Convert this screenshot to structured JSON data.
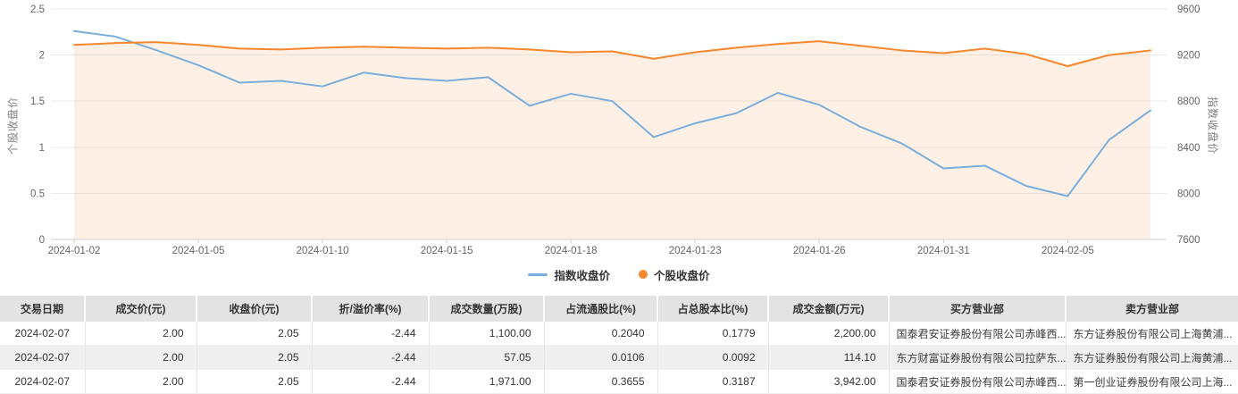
{
  "chart": {
    "left_axis_title": "个股收盘价",
    "right_axis_title": "指数收盘价",
    "legend": [
      {
        "label": "指数收盘价",
        "marker": "line",
        "color": "#79afdc"
      },
      {
        "label": "个股收盘价",
        "marker": "circle",
        "color": "#f8862c"
      }
    ]
  },
  "chart_data": {
    "type": "line",
    "title": "",
    "x": [
      "2024-01-02",
      "2024-01-03",
      "2024-01-04",
      "2024-01-05",
      "2024-01-08",
      "2024-01-09",
      "2024-01-10",
      "2024-01-11",
      "2024-01-12",
      "2024-01-15",
      "2024-01-16",
      "2024-01-17",
      "2024-01-18",
      "2024-01-19",
      "2024-01-22",
      "2024-01-23",
      "2024-01-24",
      "2024-01-25",
      "2024-01-26",
      "2024-01-29",
      "2024-01-30",
      "2024-01-31",
      "2024-02-01",
      "2024-02-02",
      "2024-02-05",
      "2024-02-06",
      "2024-02-07"
    ],
    "x_tick_indices": [
      0,
      3,
      6,
      9,
      12,
      15,
      18,
      21,
      24
    ],
    "x_tick_labels": [
      "2024-01-02",
      "2024-01-05",
      "2024-01-10",
      "2024-01-15",
      "2024-01-18",
      "2024-01-23",
      "2024-01-26",
      "2024-01-31",
      "2024-02-05"
    ],
    "left_ticks": [
      "2.5",
      "2",
      "1.5",
      "1",
      "0.5",
      "0"
    ],
    "right_ticks": [
      "9600",
      "9200",
      "8800",
      "8400",
      "8000",
      "7600"
    ],
    "left_ylim": [
      0,
      2.5
    ],
    "right_ylim": [
      7600,
      9600
    ],
    "grid": true,
    "legend_position": "bottom",
    "series": [
      {
        "name": "指数收盘价",
        "axis": "right",
        "color": "#79afdc",
        "area": false,
        "values": [
          9408,
          9360,
          9240,
          9112,
          8960,
          8976,
          8928,
          9048,
          9000,
          8976,
          9008,
          8760,
          8864,
          8800,
          8488,
          8608,
          8696,
          8872,
          8768,
          8576,
          8432,
          8216,
          8240,
          8064,
          7976,
          8464,
          8720
        ]
      },
      {
        "name": "个股收盘价",
        "axis": "left",
        "color": "#f8862c",
        "area": true,
        "fill": "rgba(249,141,52,0.13)",
        "values": [
          2.11,
          2.13,
          2.14,
          2.11,
          2.07,
          2.06,
          2.08,
          2.09,
          2.08,
          2.07,
          2.08,
          2.06,
          2.03,
          2.04,
          1.96,
          2.03,
          2.08,
          2.12,
          2.15,
          2.1,
          2.05,
          2.02,
          2.07,
          2.01,
          1.88,
          2.0,
          2.05
        ]
      }
    ]
  },
  "table": {
    "columns": [
      {
        "label": "交易日期",
        "align": "center"
      },
      {
        "label": "成交价(元)",
        "align": "right"
      },
      {
        "label": "收盘价(元)",
        "align": "right"
      },
      {
        "label": "折/溢价率(%)",
        "align": "right"
      },
      {
        "label": "成交数量(万股)",
        "align": "right"
      },
      {
        "label": "占流通股比(%)",
        "align": "right"
      },
      {
        "label": "占总股本比(%)",
        "align": "right"
      },
      {
        "label": "成交金额(万元)",
        "align": "right"
      },
      {
        "label": "买方营业部",
        "align": "left"
      },
      {
        "label": "卖方营业部",
        "align": "left"
      }
    ],
    "rows": [
      [
        "2024-02-07",
        "2.00",
        "2.05",
        "-2.44",
        "1,100.00",
        "0.2040",
        "0.1779",
        "2,200.00",
        "国泰君安证券股份有限公司赤峰西...",
        "东方证券股份有限公司上海黄浦..."
      ],
      [
        "2024-02-07",
        "2.00",
        "2.05",
        "-2.44",
        "57.05",
        "0.0106",
        "0.0092",
        "114.10",
        "东方财富证券股份有限公司拉萨东...",
        "东方证券股份有限公司上海黄浦..."
      ],
      [
        "2024-02-07",
        "2.00",
        "2.05",
        "-2.44",
        "1,971.00",
        "0.3655",
        "0.3187",
        "3,942.00",
        "国泰君安证券股份有限公司赤峰西...",
        "第一创业证券股份有限公司上海..."
      ]
    ]
  }
}
